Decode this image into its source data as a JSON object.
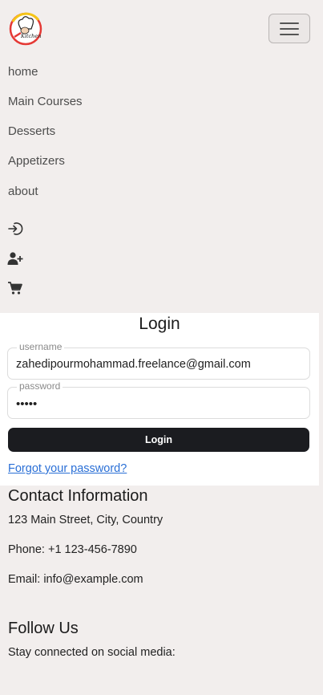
{
  "nav": {
    "logo_text": "Kitchen",
    "links": [
      {
        "label": "home"
      },
      {
        "label": "Main Courses"
      },
      {
        "label": "Desserts"
      },
      {
        "label": "Appetizers"
      },
      {
        "label": "about"
      }
    ],
    "icons": [
      "sign-in-icon",
      "user-plus-icon",
      "cart-icon"
    ]
  },
  "login": {
    "title": "Login",
    "username_label": "username",
    "username_value": "zahedipourmohammad.freelance@gmail.com",
    "password_label": "password",
    "password_value": "•••••",
    "button_label": "Login",
    "forgot_label": "Forgot your password?"
  },
  "contact": {
    "heading": "Contact Information",
    "address": "123 Main Street, City, Country",
    "phone": "Phone: +1 123-456-7890",
    "email": "Email: info@example.com"
  },
  "follow": {
    "heading": "Follow Us",
    "text": "Stay connected on social media:"
  },
  "colors": {
    "background": "#f2eeed",
    "button": "#1b1c20",
    "link": "#2a6fd6"
  }
}
